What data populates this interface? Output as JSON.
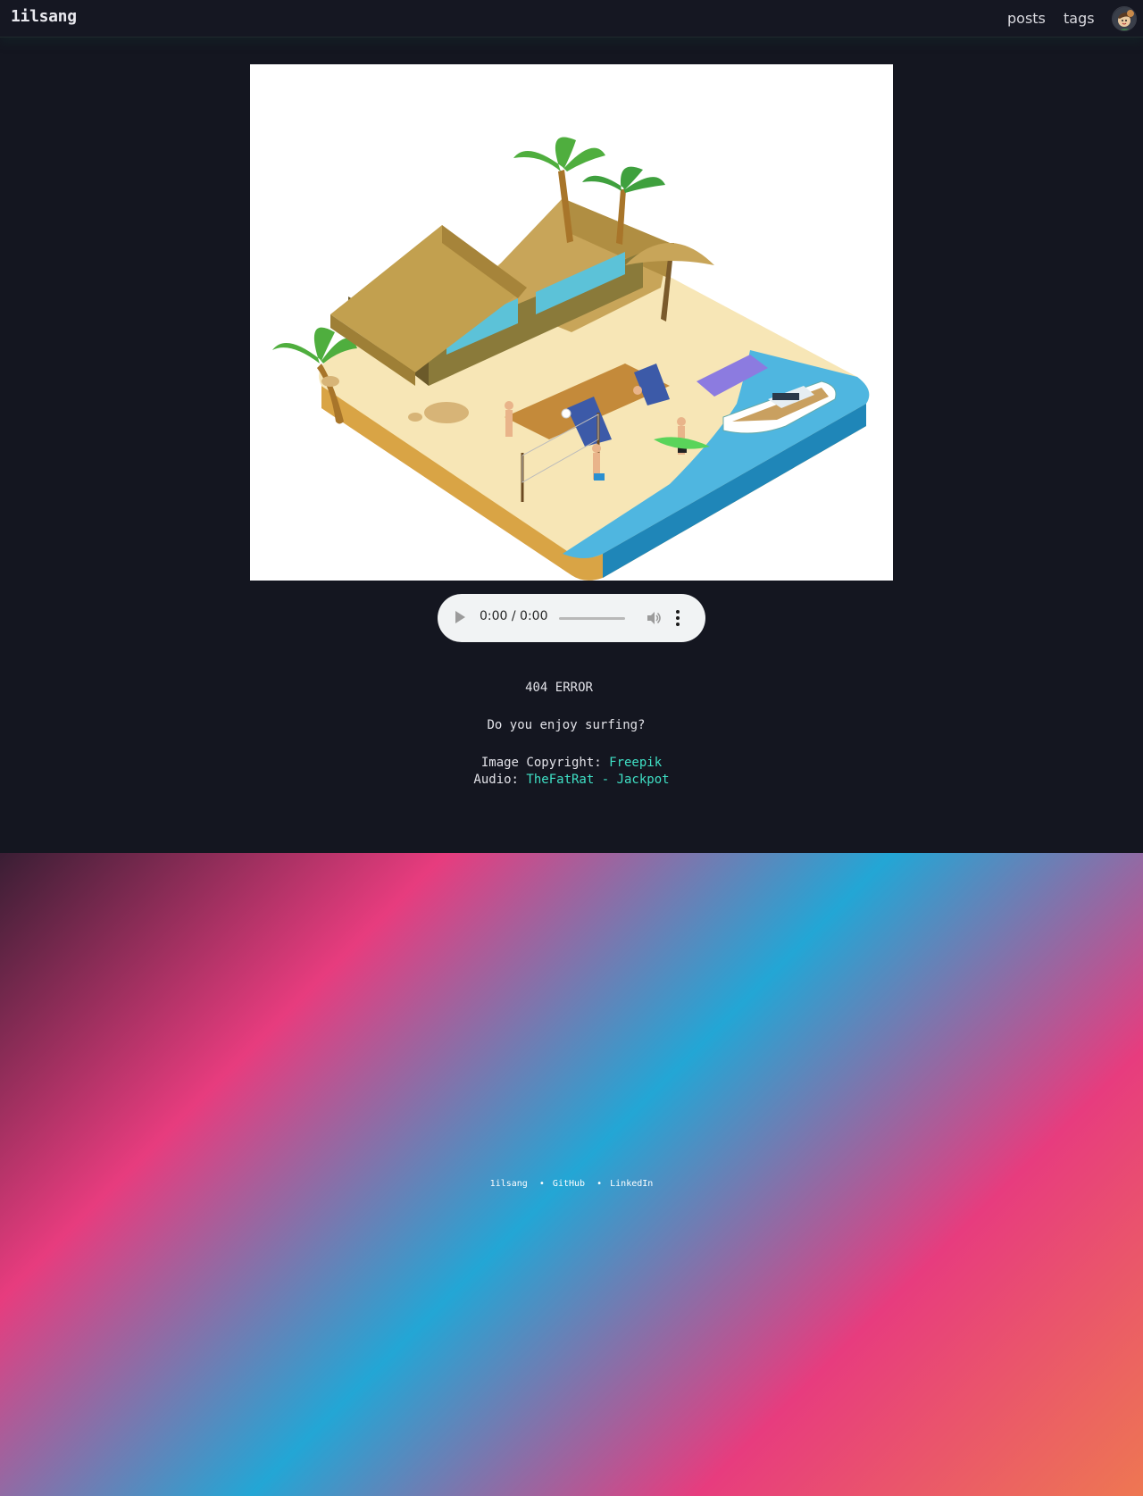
{
  "header": {
    "brand": "1ilsang",
    "nav": [
      {
        "label": "posts"
      },
      {
        "label": "tags"
      }
    ],
    "avatar_icon": "profile-avatar-icon"
  },
  "hero": {
    "image_icon": "isometric-beach-island-illustration"
  },
  "audio": {
    "time": "0:00 / 0:00",
    "play_icon": "play-icon",
    "volume_icon": "volume-icon",
    "more_icon": "more-vertical-icon"
  },
  "message": {
    "error": "404 ERROR",
    "question": "Do you enjoy surfing?",
    "image_copyright_label": "Image Copyright:",
    "image_copyright_link": "Freepik",
    "audio_label": "Audio:",
    "audio_link": "TheFatRat - Jackpot"
  },
  "footer": {
    "links": [
      {
        "label": "1ilsang"
      },
      {
        "label": "GitHub"
      },
      {
        "label": "LinkedIn"
      }
    ],
    "separator": "•"
  },
  "colors": {
    "background": "#141620",
    "link": "#3fe0c5",
    "gradient": [
      "#3a1e34",
      "#e73c7e",
      "#23a6d5",
      "#e73c7e",
      "#ee7752"
    ]
  }
}
